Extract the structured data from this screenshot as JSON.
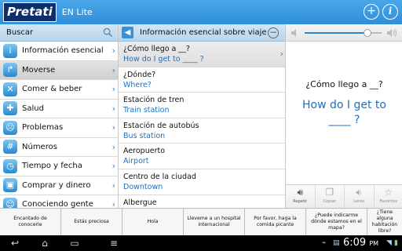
{
  "app": {
    "logo": "Pretati",
    "subtitle": "EN Lite"
  },
  "header_icons": [
    "add-circle-icon",
    "info-circle-icon"
  ],
  "search": {
    "label": "Buscar"
  },
  "categories": [
    {
      "label": "Información esencial",
      "icon": "info-icon"
    },
    {
      "label": "Moverse",
      "icon": "turn-arrow-icon"
    },
    {
      "label": "Comer & beber",
      "icon": "fork-knife-icon"
    },
    {
      "label": "Salud",
      "icon": "health-icon"
    },
    {
      "label": "Problemas",
      "icon": "sad-face-icon"
    },
    {
      "label": "Números",
      "icon": "numbers-icon"
    },
    {
      "label": "Tiempo y fecha",
      "icon": "clock-icon"
    },
    {
      "label": "Comprar y dinero",
      "icon": "shopping-icon"
    },
    {
      "label": "Conociendo gente",
      "icon": "people-icon"
    }
  ],
  "phrase_list": {
    "title": "Información esencial sobre viaje",
    "items": [
      {
        "src": "¿Cómo llego a __?",
        "tgt": "How do I get to ____ ?"
      },
      {
        "src": "¿Dónde?",
        "tgt": "Where?"
      },
      {
        "src": "Estación de tren",
        "tgt": "Train station"
      },
      {
        "src": "Estación de autobús",
        "tgt": "Bus station"
      },
      {
        "src": "Aeropuerto",
        "tgt": "Airport"
      },
      {
        "src": "Centro de la ciudad",
        "tgt": "Downtown"
      },
      {
        "src": "Albergue",
        "tgt": ""
      }
    ]
  },
  "detail": {
    "src": "¿Cómo llego a __?",
    "tgt": "How do I get to ____ ?",
    "volume_fraction": 0.82,
    "actions": [
      {
        "label": "Repetir",
        "icon": "speaker-icon"
      },
      {
        "label": "Copiar",
        "icon": "copy-icon"
      },
      {
        "label": "Lento",
        "icon": "slow-speaker-icon"
      },
      {
        "label": "Favoritos",
        "icon": "star-icon"
      }
    ]
  },
  "quick_phrases": [
    "Encantado de conocerle",
    "Estás preciosa",
    "Hola",
    "Lleveme a un hospital internacional",
    "Por favor, haga la comida picante",
    "¿Puede indicarme dónde estamos en el mapa?",
    "¿Tiene alguna habitación libre?"
  ],
  "system": {
    "time": "6:09",
    "time_suffix": "PM"
  },
  "colors": {
    "accent": "#2f8fd8",
    "target_text": "#1f6fc0",
    "logo_bg": "#0d2e6b"
  }
}
